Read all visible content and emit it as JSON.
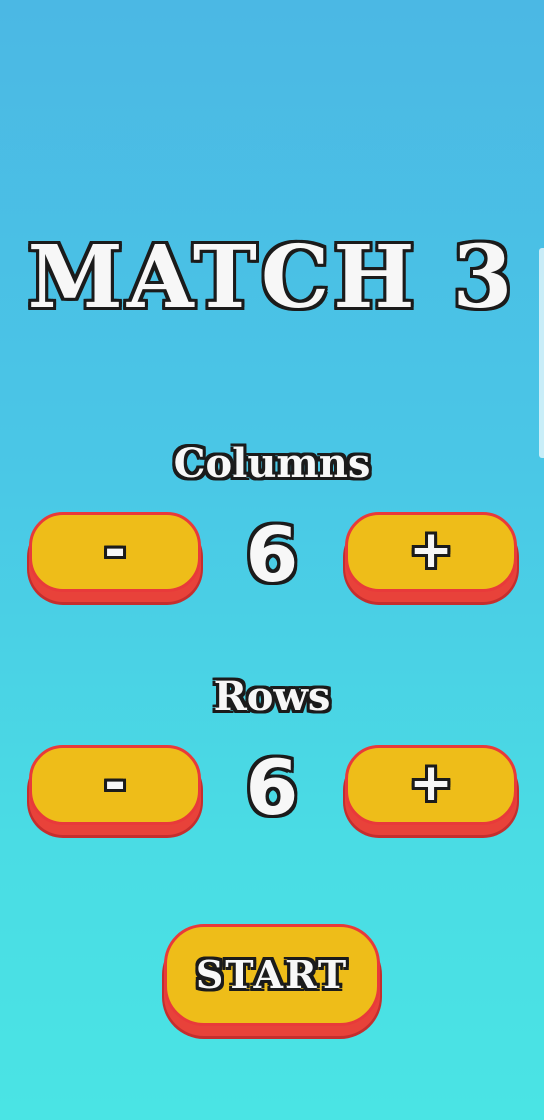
{
  "title": "MATCH 3",
  "columns": {
    "label": "Columns",
    "value": "6",
    "minus_label": "-",
    "plus_label": "+"
  },
  "rows": {
    "label": "Rows",
    "value": "6",
    "minus_label": "-",
    "plus_label": "+"
  },
  "start_label": "START",
  "colors": {
    "background_top": "#4BB8E4",
    "background_bottom": "#4AE4E4",
    "button_fill": "#EEBD19",
    "button_shadow": "#E8423A",
    "text_fill": "#F7F7F7",
    "text_outline": "#1B1B1B"
  }
}
